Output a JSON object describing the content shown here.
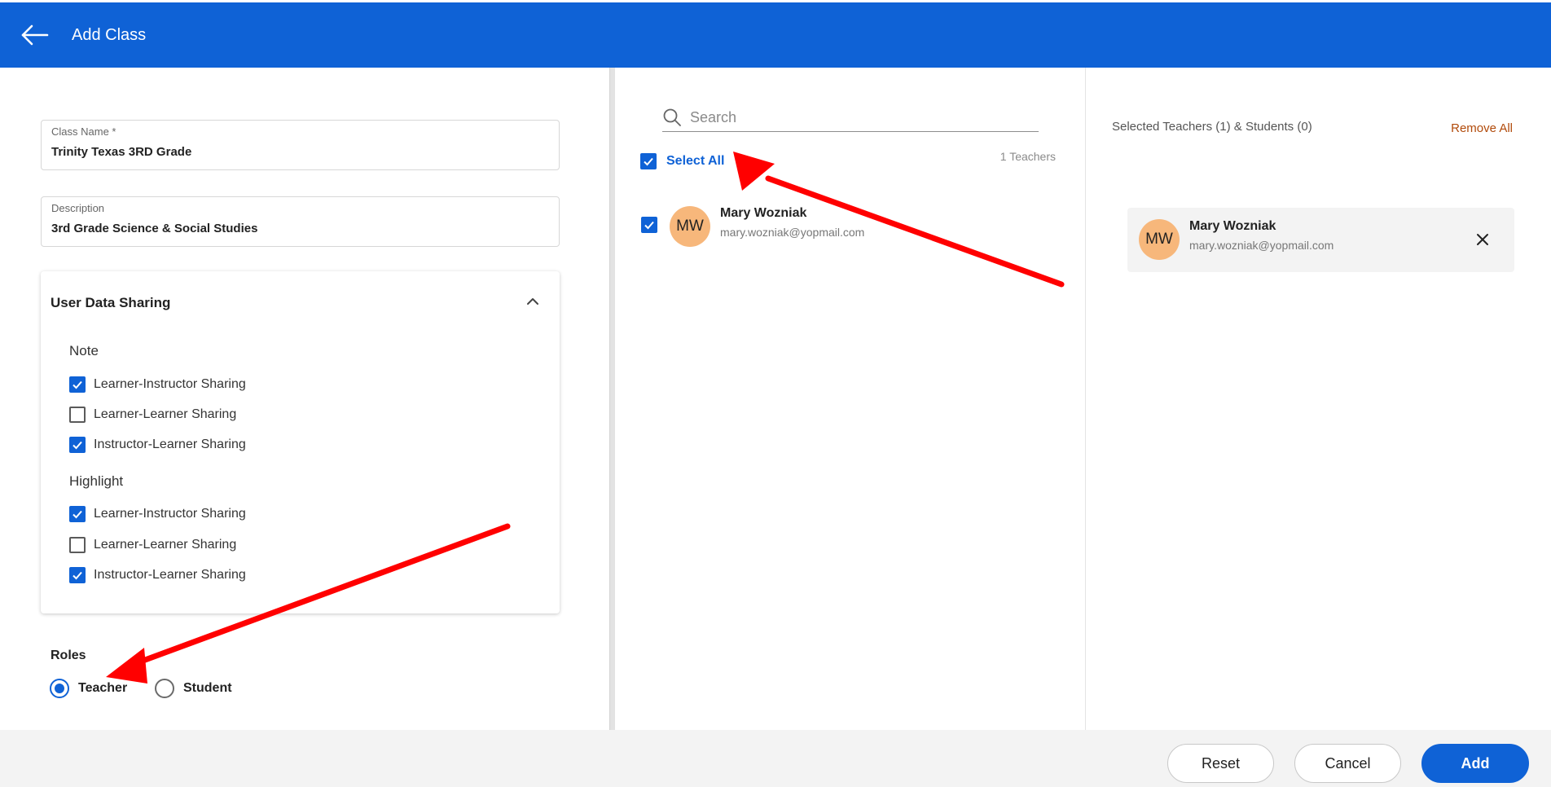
{
  "header": {
    "title": "Add Class",
    "back_icon": "arrow-left-icon"
  },
  "form": {
    "class_name": {
      "label": "Class Name *",
      "value": "Trinity Texas 3RD Grade"
    },
    "description": {
      "label": "Description",
      "value": "3rd Grade Science & Social Studies"
    }
  },
  "sharing": {
    "title": "User Data Sharing",
    "groups": [
      {
        "label": "Note",
        "options": [
          {
            "label": "Learner-Instructor Sharing",
            "checked": true
          },
          {
            "label": "Learner-Learner Sharing",
            "checked": false
          },
          {
            "label": "Instructor-Learner Sharing",
            "checked": true
          }
        ]
      },
      {
        "label": "Highlight",
        "options": [
          {
            "label": "Learner-Instructor Sharing",
            "checked": true
          },
          {
            "label": "Learner-Learner Sharing",
            "checked": false
          },
          {
            "label": "Instructor-Learner Sharing",
            "checked": true
          }
        ]
      }
    ]
  },
  "roles": {
    "label": "Roles",
    "options": [
      {
        "label": "Teacher",
        "selected": true
      },
      {
        "label": "Student",
        "selected": false
      }
    ]
  },
  "search": {
    "placeholder": "Search",
    "value": ""
  },
  "list": {
    "select_all_label": "Select All",
    "select_all_checked": true,
    "count_text": "1 Teachers",
    "people": [
      {
        "initials": "MW",
        "name": "Mary Wozniak",
        "email": "mary.wozniak@yopmail.com",
        "checked": true
      }
    ]
  },
  "selected": {
    "summary": "Selected Teachers (1) & Students (0)",
    "remove_all_label": "Remove All",
    "people": [
      {
        "initials": "MW",
        "name": "Mary Wozniak",
        "email": "mary.wozniak@yopmail.com"
      }
    ]
  },
  "footer": {
    "reset_label": "Reset",
    "cancel_label": "Cancel",
    "add_label": "Add"
  },
  "colors": {
    "primary": "#0f62d6",
    "avatar": "#f7b77b",
    "remove_all": "#b14a0a",
    "annotation": "#ff0000"
  }
}
